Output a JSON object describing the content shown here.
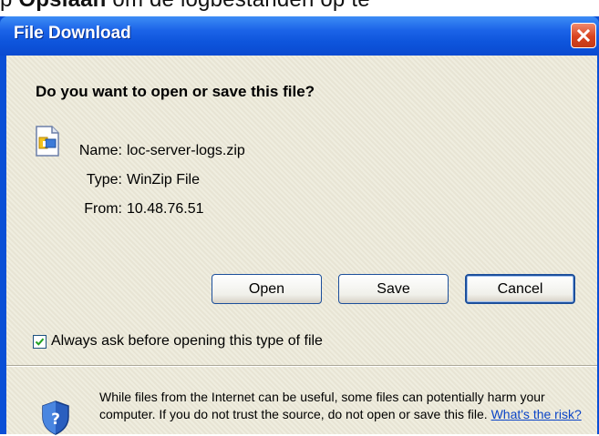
{
  "background_text": {
    "prefix": "p ",
    "bold": "Opslaan",
    "suffix": " om de logbestanden op te"
  },
  "dialog": {
    "title": "File Download",
    "close_icon": "close-icon",
    "question": "Do you want to open or save this file?",
    "file_icon": "winzip-file-icon",
    "fields": [
      {
        "label": "Name:",
        "value": "loc-server-logs.zip"
      },
      {
        "label": "Type:",
        "value": "WinZip File"
      },
      {
        "label": "From:",
        "value": "10.48.76.51"
      }
    ],
    "buttons": {
      "open": "Open",
      "save": "Save",
      "cancel": "Cancel"
    },
    "checkbox": {
      "label": "Always ask before opening this type of file",
      "checked": true
    },
    "warning": {
      "text": "While files from the Internet can be useful, some files can potentially harm your computer. If you do not trust the source, do not open or save this file. ",
      "link": "What's the risk?",
      "icon": "shield-icon"
    }
  },
  "colors": {
    "title_bar": "#0a4fd6",
    "client": "#ece9d8",
    "close_button": "#d8431f",
    "link": "#0b44c7"
  }
}
